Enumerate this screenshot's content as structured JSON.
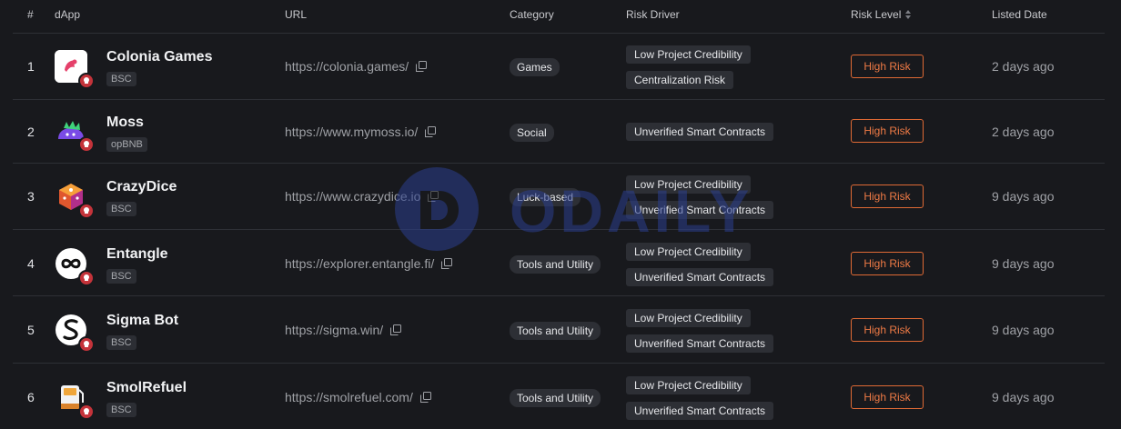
{
  "header": {
    "num": "#",
    "dapp": "dApp",
    "url": "URL",
    "category": "Category",
    "risk_driver": "Risk Driver",
    "risk_level": "Risk Level",
    "listed_date": "Listed Date"
  },
  "rows": [
    {
      "num": "1",
      "name": "Colonia Games",
      "chain": "BSC",
      "url": "https://colonia.games/",
      "category": "Games",
      "drivers": [
        "Low Project Credibility",
        "Centralization Risk"
      ],
      "risk": "High Risk",
      "date": "2 days ago",
      "logo_icon": "colonia-logo-icon"
    },
    {
      "num": "2",
      "name": "Moss",
      "chain": "opBNB",
      "url": "https://www.mymoss.io/",
      "category": "Social",
      "drivers": [
        "Unverified Smart Contracts"
      ],
      "risk": "High Risk",
      "date": "2 days ago",
      "logo_icon": "moss-logo-icon"
    },
    {
      "num": "3",
      "name": "CrazyDice",
      "chain": "BSC",
      "url": "https://www.crazydice.io",
      "category": "Luck-based",
      "drivers": [
        "Low Project Credibility",
        "Unverified Smart Contracts"
      ],
      "risk": "High Risk",
      "date": "9 days ago",
      "logo_icon": "crazydice-logo-icon"
    },
    {
      "num": "4",
      "name": "Entangle",
      "chain": "BSC",
      "url": "https://explorer.entangle.fi/",
      "category": "Tools and Utility",
      "drivers": [
        "Low Project Credibility",
        "Unverified Smart Contracts"
      ],
      "risk": "High Risk",
      "date": "9 days ago",
      "logo_icon": "entangle-logo-icon"
    },
    {
      "num": "5",
      "name": "Sigma Bot",
      "chain": "BSC",
      "url": "https://sigma.win/",
      "category": "Tools and Utility",
      "drivers": [
        "Low Project Credibility",
        "Unverified Smart Contracts"
      ],
      "risk": "High Risk",
      "date": "9 days ago",
      "logo_icon": "sigma-logo-icon"
    },
    {
      "num": "6",
      "name": "SmolRefuel",
      "chain": "BSC",
      "url": "https://smolrefuel.com/",
      "category": "Tools and Utility",
      "drivers": [
        "Low Project Credibility",
        "Unverified Smart Contracts"
      ],
      "risk": "High Risk",
      "date": "9 days ago",
      "logo_icon": "smolrefuel-logo-icon"
    }
  ],
  "watermark": "ODAILY",
  "colors": {
    "background": "#18191d",
    "risk_accent": "#e06a35",
    "divider": "#2e3036",
    "warning_badge": "#c4333a"
  }
}
